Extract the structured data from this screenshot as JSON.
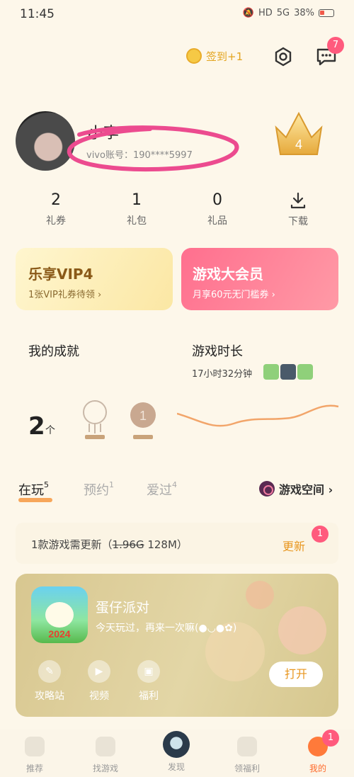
{
  "status_bar": {
    "time": "11:45",
    "network": "5G",
    "battery": "38%",
    "hd": "HD"
  },
  "header": {
    "checkin_label": "签到+1",
    "message_badge": "7"
  },
  "profile": {
    "username": "小李",
    "account": "vivo账号：190****5997",
    "vip_level": "4"
  },
  "stats": [
    {
      "value": "2",
      "label": "礼券"
    },
    {
      "value": "1",
      "label": "礼包"
    },
    {
      "value": "0",
      "label": "礼品"
    }
  ],
  "download_label": "下载",
  "vip_card": {
    "title": "乐享VIP4",
    "subtitle": "1张VIP礼券待领 ›"
  },
  "member_card": {
    "title": "游戏大会员",
    "subtitle": "月享60元无门槛券 ›"
  },
  "achievements": {
    "title": "我的成就",
    "count": "2",
    "unit": "个"
  },
  "playtime": {
    "title": "游戏时长",
    "value": "17小时32分钟"
  },
  "tabs": [
    {
      "label": "在玩",
      "count": "5"
    },
    {
      "label": "预约",
      "count": "1"
    },
    {
      "label": "爱过",
      "count": "4"
    }
  ],
  "game_space": "游戏空间 ›",
  "update": {
    "prefix": "1款游戏需更新（",
    "old_size": "1.96G",
    "new_size": " 128M）",
    "button": "更新",
    "badge": "1"
  },
  "game": {
    "name": "蛋仔派对",
    "description": "今天玩过，再来一次嘛(●◡●✿)",
    "actions": [
      "攻略站",
      "视频",
      "福利"
    ],
    "open_button": "打开"
  },
  "bottom_nav": {
    "items": [
      "推荐",
      "找游戏",
      "发现",
      "领福利",
      "我的"
    ],
    "badge": "1"
  },
  "colors": {
    "accent": "#e8961f",
    "badge": "#ff5a7d",
    "member": "#ff6f8e"
  }
}
